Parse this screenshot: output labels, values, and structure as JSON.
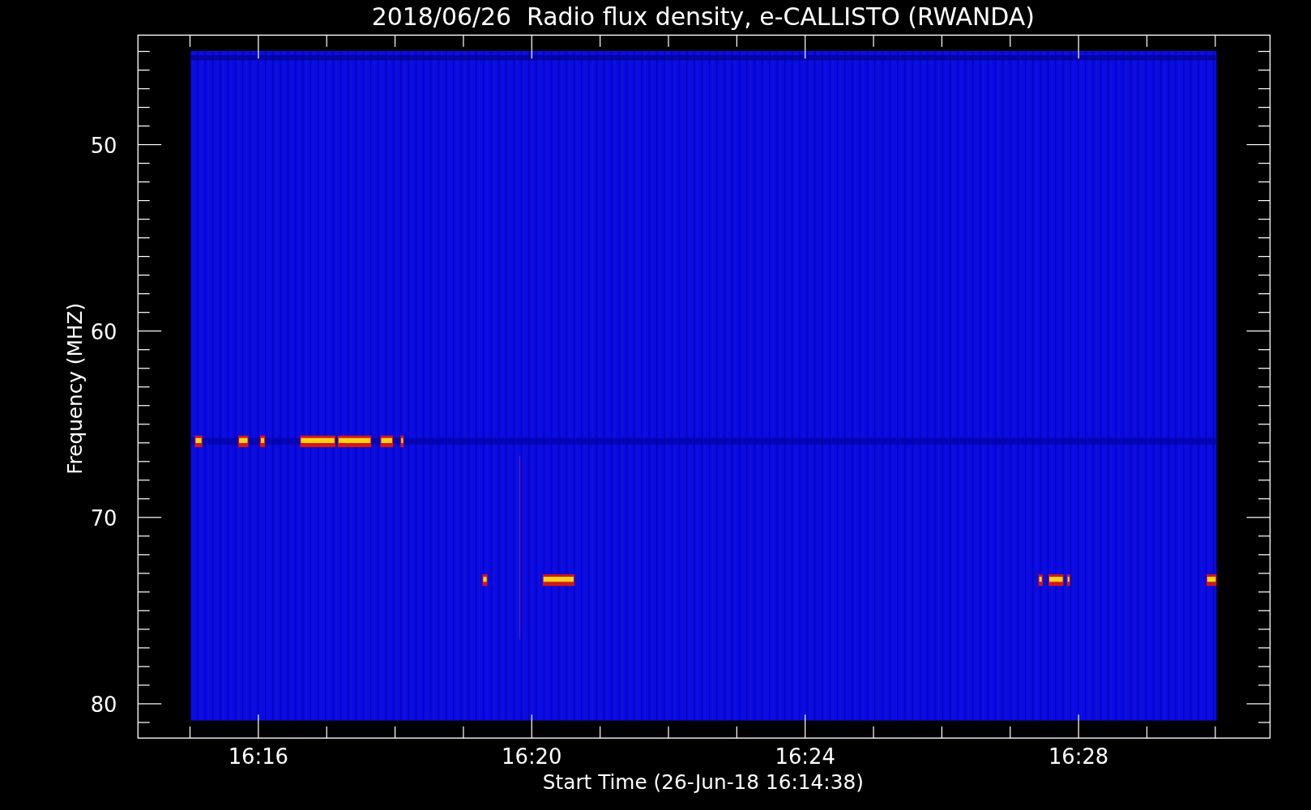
{
  "title": "2018/06/26  Radio flux density, e-CALLISTO (RWANDA)",
  "plot": {
    "ylabel": "Frequency (MHZ)",
    "xlabel": "Start Time (26-Jun-18 16:14:38)",
    "yticks": [
      "50",
      "60",
      "70",
      "80"
    ],
    "xticks": [
      "16:16",
      "16:20",
      "16:24",
      "16:28"
    ]
  }
}
